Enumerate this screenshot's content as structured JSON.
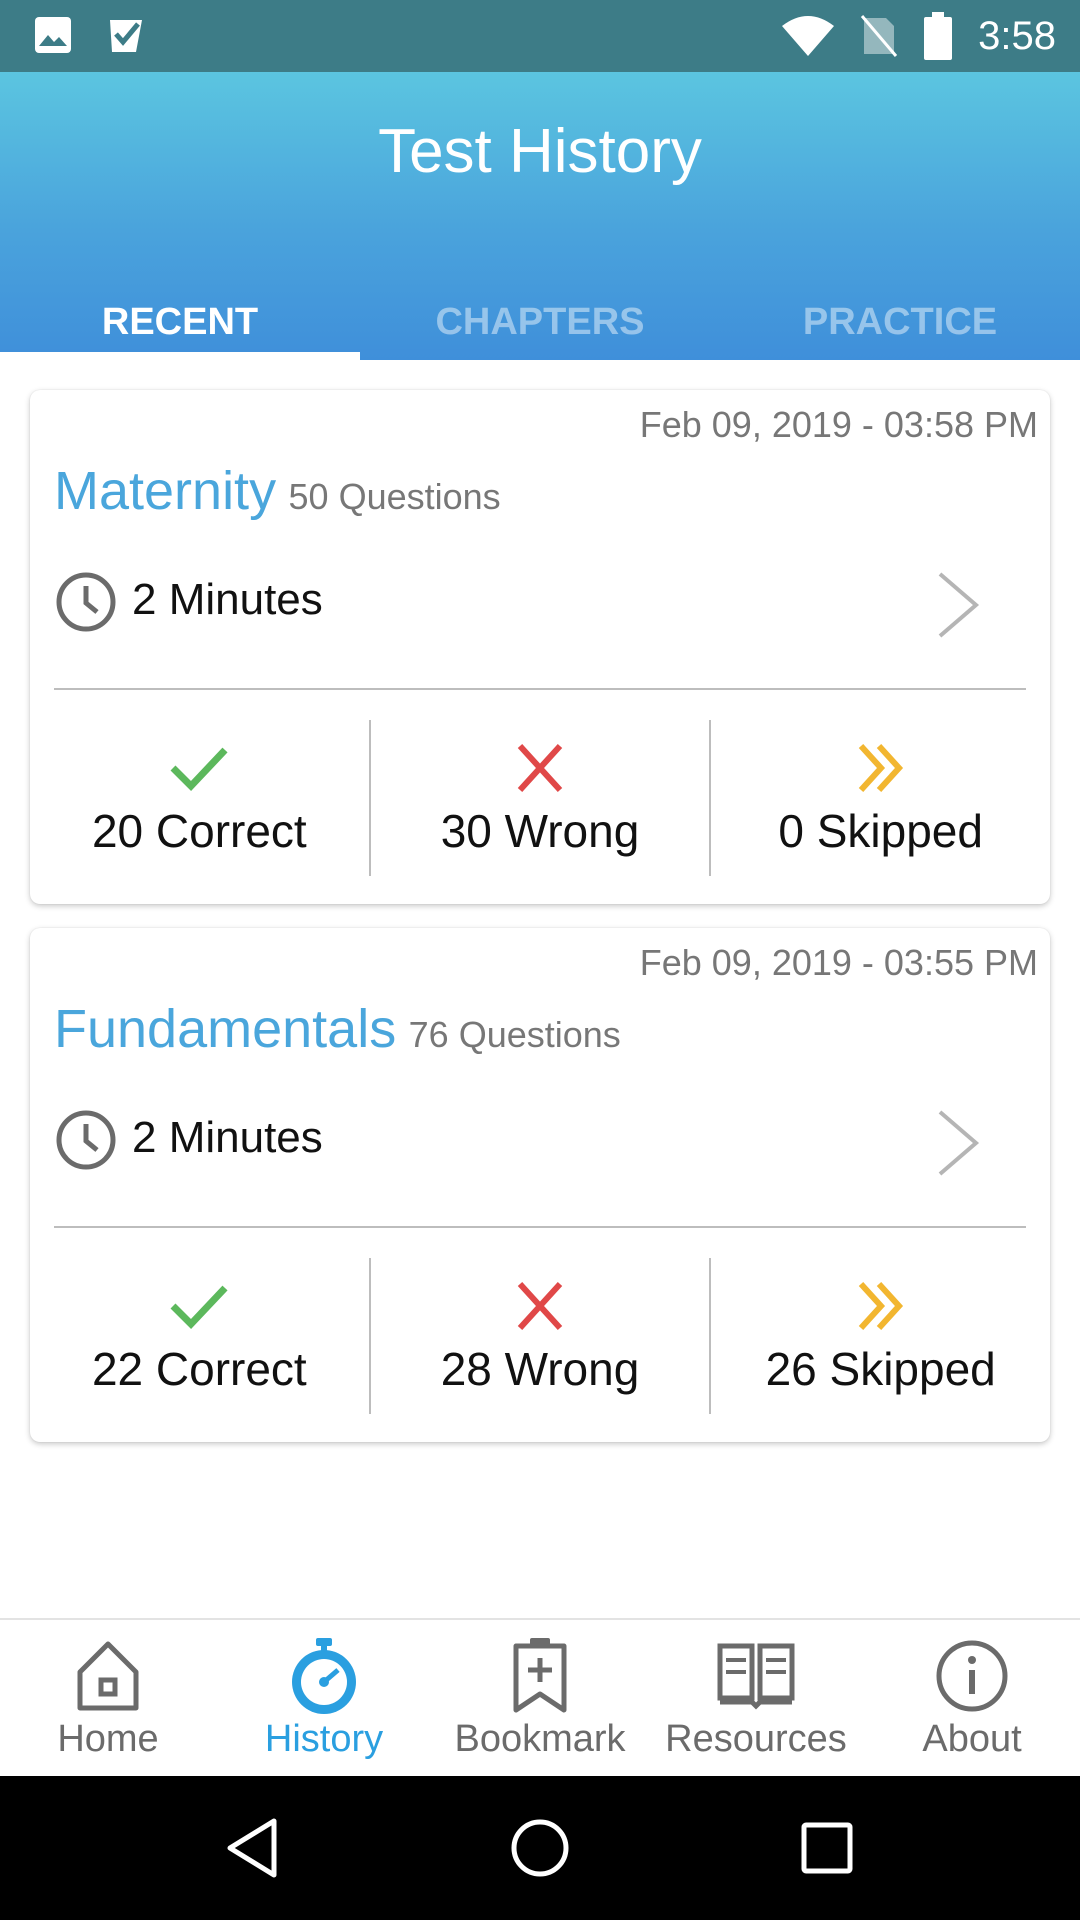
{
  "status_bar": {
    "time": "3:58"
  },
  "header": {
    "title": "Test History"
  },
  "tabs": [
    {
      "label": "RECENT",
      "active": true
    },
    {
      "label": "CHAPTERS",
      "active": false
    },
    {
      "label": "PRACTICE",
      "active": false
    }
  ],
  "tests": [
    {
      "date": "Feb 09, 2019 - 03:58 PM",
      "title": "Maternity",
      "questions": "50 Questions",
      "duration": "2 Minutes",
      "correct": "20 Correct",
      "wrong": "30 Wrong",
      "skipped": "0 Skipped"
    },
    {
      "date": "Feb 09, 2019 - 03:55 PM",
      "title": "Fundamentals",
      "questions": "76 Questions",
      "duration": "2 Minutes",
      "correct": "22 Correct",
      "wrong": "28 Wrong",
      "skipped": "26 Skipped"
    }
  ],
  "bottom_nav": [
    {
      "label": "Home",
      "icon": "home-icon",
      "active": false
    },
    {
      "label": "History",
      "icon": "stopwatch-icon",
      "active": true
    },
    {
      "label": "Bookmark",
      "icon": "bookmark-icon",
      "active": false
    },
    {
      "label": "Resources",
      "icon": "book-icon",
      "active": false
    },
    {
      "label": "About",
      "icon": "info-icon",
      "active": false
    }
  ],
  "colors": {
    "status_bar": "#3d7c87",
    "header_top": "#5bc5e0",
    "header_bottom": "#3f8fda",
    "accent": "#4aa6dc",
    "correct": "#5cb85c",
    "wrong": "#e04848",
    "skipped": "#f2b630"
  }
}
